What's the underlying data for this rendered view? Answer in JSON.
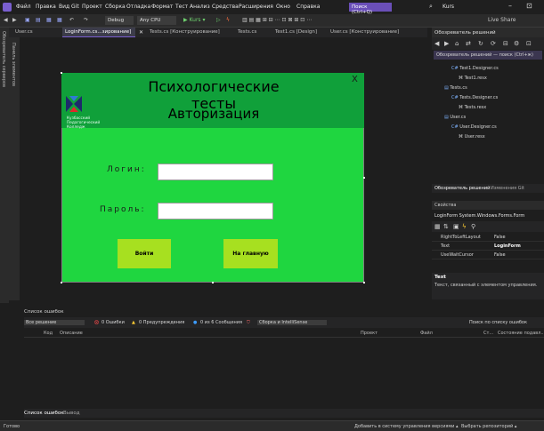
{
  "menu": {
    "items": [
      "Файл",
      "Правка",
      "Вид",
      "Git",
      "Проект",
      "Сборка",
      "Отладка",
      "Формат",
      "Тест",
      "Анализ",
      "Средства",
      "Расширения",
      "Окно",
      "Справка"
    ],
    "search": "Поиск (Ctrl+Q)",
    "solution_name": "Kurs",
    "minimize": "–",
    "maximize": "⊡"
  },
  "toolbar": {
    "config": "Debug",
    "platform": "Any CPU",
    "start": "▶ Kurs ▾",
    "live_share": "Live Share"
  },
  "left_strip": {
    "label": "Обозреватель серверов"
  },
  "toolbox_strip": {
    "label": "Панель элементов"
  },
  "tabs": [
    {
      "label": "User.cs"
    },
    {
      "label": "LoginForm.cs...зирование]"
    },
    {
      "label": "Tests.cs [Конструирование]"
    },
    {
      "label": "Tests.cs"
    },
    {
      "label": "Test1.cs [Design]"
    },
    {
      "label": "User.cs [Конструирование]"
    }
  ],
  "form": {
    "title": "Психологические тесты",
    "subtitle": "Авторизация",
    "close": "X",
    "college": "Кузбасский\nПедагогический\nКолледж",
    "login_label": "Логин:",
    "password_label": "Пароль:",
    "btn_login": "Войти",
    "btn_home": "На главную",
    "login_value": "",
    "password_value": "",
    "colors": {
      "header": "#10a03a",
      "body": "#1fd640",
      "buttons": "#a7e020"
    }
  },
  "solution_explorer": {
    "title": "Обозреватель решений",
    "search": "Обозреватель решений — поиск (Ctrl+ж)",
    "tree": [
      {
        "label": "Test1.Designer.cs",
        "prefix": "C#"
      },
      {
        "label": "Test1.resx",
        "prefix": ""
      },
      {
        "label": "Tests.cs",
        "prefix": ""
      },
      {
        "label": "Tests.Designer.cs",
        "prefix": "C#"
      },
      {
        "label": "Tests.resx",
        "prefix": ""
      },
      {
        "label": "User.cs",
        "prefix": ""
      },
      {
        "label": "User.Designer.cs",
        "prefix": "C#"
      },
      {
        "label": "User.resx",
        "prefix": ""
      }
    ],
    "bottom_tabs": [
      "Обозреватель решений",
      "Изменения Git"
    ]
  },
  "properties": {
    "title": "Свойства",
    "object": "LoginForm  System.Windows.Forms.Form",
    "rows": [
      {
        "name": "RightToLeftLayout",
        "value": "False"
      },
      {
        "name": "Text",
        "value": "LoginForm"
      },
      {
        "name": "UseWaitCursor",
        "value": "False"
      }
    ],
    "desc_title": "Text",
    "desc_text": "Текст, связанный с элементом управления."
  },
  "error_list": {
    "title": "Список ошибок",
    "scope": "Все решение",
    "errors": "0 Ошибки",
    "warnings": "0 Предупреждения",
    "messages": "0 из 6 Сообщения",
    "build": "Сборка и IntelliSense",
    "search": "Поиск по списку ошибок",
    "columns": {
      "code": "Код",
      "desc": "Описание",
      "project": "Проект",
      "file": "Файл",
      "line": "Ст...",
      "state": "Состояние подавл..."
    }
  },
  "bottom_tabs": [
    "Список ошибок",
    "Вывод"
  ],
  "status": {
    "ready": "Готово",
    "add_source": "Добавить в систему управления версиями ▴",
    "select_repo": "Выбрать репозиторий ▴"
  }
}
